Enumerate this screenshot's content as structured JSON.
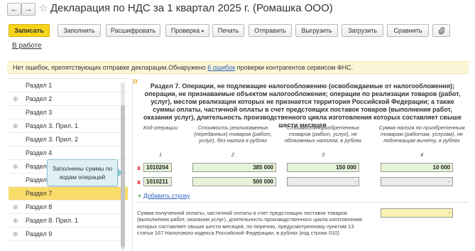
{
  "window": {
    "title": "Декларация по НДС за 1 квартал 2025 г. (Ромашка ООО)",
    "back_glyph": "←",
    "forward_glyph": "→",
    "star_glyph": "☆"
  },
  "toolbar": {
    "record": "Записать",
    "fill": "Заполнить",
    "expand": "Расшифровать",
    "check": "Проверка",
    "check_arrow": "▾",
    "print": "Печать",
    "send": "Отправить",
    "upload": "Выгрузить",
    "load": "Загрузить",
    "compare": "Сравнить",
    "attach_icon": "paperclip-icon"
  },
  "status": "В работе",
  "infobar": {
    "text_before": "Нет ошибок, препятствующих отправке декларации.Обнаружено ",
    "link": "6 ошибок",
    "text_after": " проверки контрагентов сервисом ФНС."
  },
  "sidebar": {
    "items": [
      {
        "label": "Раздел 1",
        "expand": ""
      },
      {
        "label": "Раздел 2",
        "expand": "⊕"
      },
      {
        "label": "Раздел 3",
        "expand": ""
      },
      {
        "label": "Раздел 3. Прил. 1",
        "expand": "⊕"
      },
      {
        "label": "Раздел 3. Прил. 2",
        "expand": ""
      },
      {
        "label": "Раздел 4",
        "expand": ""
      },
      {
        "label": "Раздел 5",
        "expand": "⊕"
      },
      {
        "label": "Раздел 6",
        "expand": ""
      },
      {
        "label": "Раздел 7",
        "expand": ""
      },
      {
        "label": "Раздел 8",
        "expand": "⊕"
      },
      {
        "label": "Раздел 8. Прил. 1",
        "expand": "⊕"
      },
      {
        "label": "Раздел 9",
        "expand": "⊕"
      }
    ],
    "selected_index": 8
  },
  "callout": "Заполнены суммы по кодам операций",
  "section": {
    "heading": "Раздел 7. Операции, не подлежащие налогообложению (освобождаемые от налогообложения); операции, не признаваемые объектом налогообложения; операции по реализации товаров (работ, услуг), местом реализации которых не признается территория Российской Федерации; а также суммы оплаты, частичной оплаты в счет предстоящих поставок товаров (выполнения работ, оказания услуг), длительность производственного цикла изготовления которых составляет свыше шести месяцев",
    "columns": [
      {
        "header": "Код операции",
        "num": "1"
      },
      {
        "header": "Стоимость реализованных (переданных) товаров (работ, услуг), без налога в рублях",
        "num": "2"
      },
      {
        "header": "Стоимость приобретенных товаров (работ, услуг), не облагаемых налогом, в рублях",
        "num": "3"
      },
      {
        "header": "Сумма налога по приобретенным товарам (работам, услугам), не подлежащая вычету, в рублях",
        "num": "4"
      }
    ],
    "rows": [
      {
        "mark": "x",
        "code": "1010204",
        "col2": "385 000",
        "col3": "150 000",
        "col4": "10 000"
      },
      {
        "mark": "x",
        "code": "1010211",
        "col2": "500 000",
        "col3": "-",
        "col4": "-"
      }
    ],
    "add_row": "Добавить строку",
    "note": "Сумма полученной оплаты, частичной оплаты в счет предстоящих поставок товаров (выполнения работ, оказания услуг), длительность производственного цикла изготовления которых составляет свыше шести месяцев, по перечню, предусмотренному пунктом 13 статьи 167 Налогового кодекса Российской Федерации, в рублях (код строки 010)",
    "note_value": "-"
  }
}
